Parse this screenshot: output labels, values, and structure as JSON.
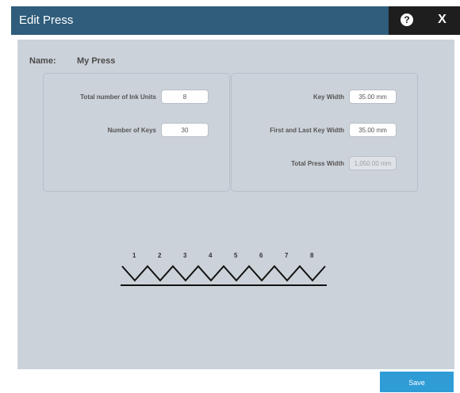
{
  "dialog": {
    "title": "Edit Press",
    "help_glyph": "?",
    "close_glyph": "X"
  },
  "name": {
    "label": "Name:",
    "value": "My Press"
  },
  "left_panel": {
    "ink_units_label": "Total number of Ink Units",
    "ink_units_value": "8",
    "keys_label": "Number of Keys",
    "keys_value": "30"
  },
  "right_panel": {
    "key_width_label": "Key Width",
    "key_width_value": "35.00 mm",
    "first_last_label": "First and Last Key Width",
    "first_last_value": "35.00 mm",
    "total_width_label": "Total Press Width",
    "total_width_value": "1,050.00 mm"
  },
  "diagram": {
    "unit_numbers": [
      "1",
      "2",
      "3",
      "4",
      "5",
      "6",
      "7",
      "8"
    ]
  },
  "footer": {
    "save_label": "Save"
  },
  "colors": {
    "titlebar": "#2f5d7b",
    "content_bg": "#ccd2d9",
    "save": "#2f9cd6"
  }
}
